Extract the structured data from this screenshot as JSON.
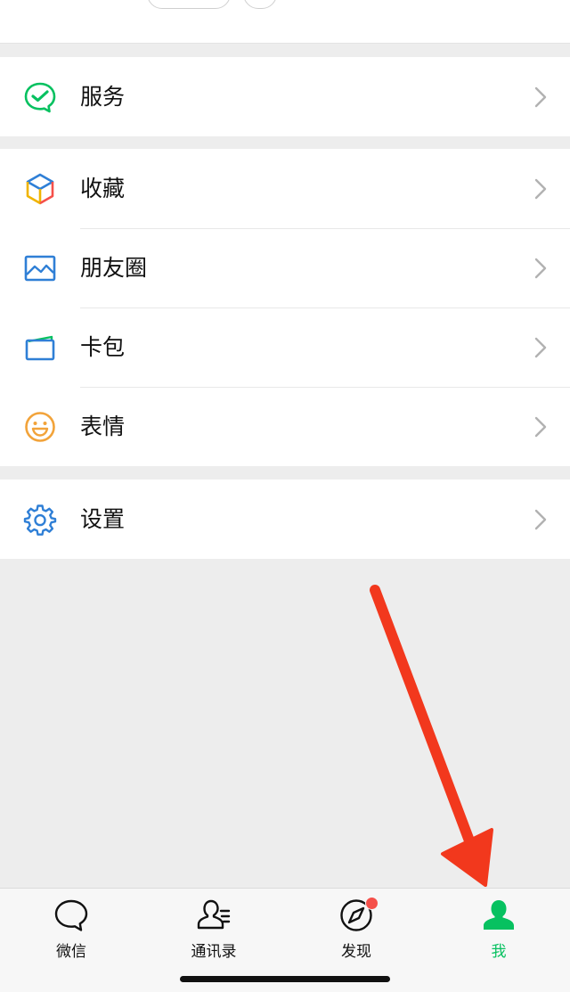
{
  "menu": {
    "groups": [
      {
        "items": [
          {
            "label": "服务",
            "icon": "pay-service-icon",
            "color": "#07c160"
          }
        ]
      },
      {
        "items": [
          {
            "label": "收藏",
            "icon": "favorites-cube-icon",
            "color": "#f0b400"
          },
          {
            "label": "朋友圈",
            "icon": "moments-image-icon",
            "color": "#2f7fd6"
          },
          {
            "label": "卡包",
            "icon": "card-wallet-icon",
            "color": "#2f7fd6"
          },
          {
            "label": "表情",
            "icon": "sticker-smile-icon",
            "color": "#f2a33a"
          }
        ]
      },
      {
        "items": [
          {
            "label": "设置",
            "icon": "settings-gear-icon",
            "color": "#2f7fd6"
          }
        ]
      }
    ]
  },
  "tabbar": {
    "tabs": [
      {
        "label": "微信",
        "icon": "chat-bubble-icon",
        "active": false
      },
      {
        "label": "通讯录",
        "icon": "contacts-icon",
        "active": false
      },
      {
        "label": "发现",
        "icon": "discover-compass-icon",
        "active": false,
        "badge_dot": true
      },
      {
        "label": "我",
        "icon": "me-person-icon",
        "active": true
      }
    ]
  },
  "colors": {
    "accent": "#07c160",
    "badge": "#f5504a",
    "annotation_arrow": "#f2381d",
    "background": "#ededed"
  }
}
